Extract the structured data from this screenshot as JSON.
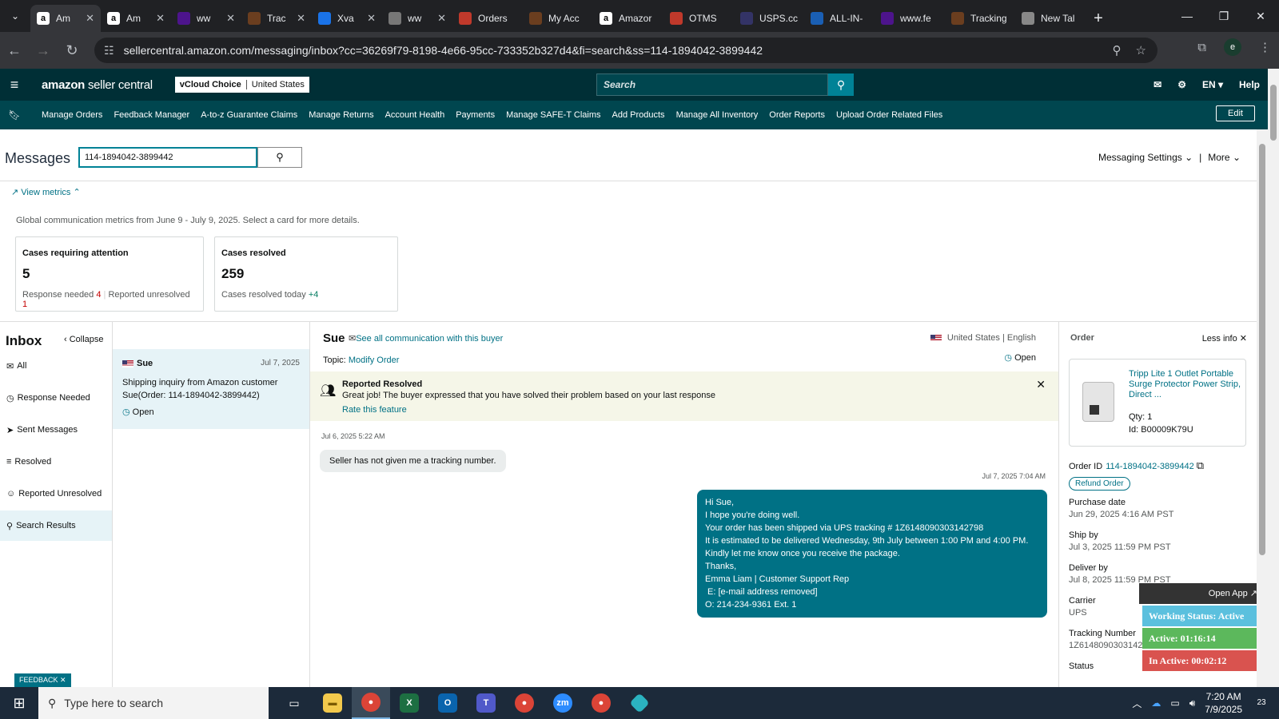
{
  "browser": {
    "tabs": [
      {
        "label": "Am",
        "icon": "amazon-icon",
        "active": true
      },
      {
        "label": "Am",
        "icon": "amazon-icon"
      },
      {
        "label": "ww",
        "icon": "fedex-icon"
      },
      {
        "label": "Trac",
        "icon": "ups-icon"
      },
      {
        "label": "Xva",
        "icon": "google-docs-icon"
      },
      {
        "label": "ww",
        "icon": "globe-icon"
      },
      {
        "label": "Orders",
        "icon": "orders-icon"
      },
      {
        "label": "My Acc",
        "icon": "ups-icon"
      },
      {
        "label": "Amazor",
        "icon": "amazon-icon"
      },
      {
        "label": "OTMS",
        "icon": "otms-icon"
      },
      {
        "label": "USPS.cc",
        "icon": "usps-icon"
      },
      {
        "label": "ALL-IN-",
        "icon": "17track-icon"
      },
      {
        "label": "www.fe",
        "icon": "fedex-icon"
      },
      {
        "label": "Tracking",
        "icon": "ups-icon"
      },
      {
        "label": "New Tal",
        "icon": "chrome-icon"
      }
    ],
    "url": "sellercentral.amazon.com/messaging/inbox?cc=36269f79-8198-4e66-95cc-733352b327d4&fi=search&ss=114-1894042-3899442",
    "profile_initial": "e"
  },
  "header": {
    "logo_main": "amazon",
    "logo_sub": "seller central",
    "account_name": "vCloud Choice",
    "account_region": "United States",
    "search_placeholder": "Search",
    "language": "EN",
    "help": "Help"
  },
  "nav": {
    "links": [
      "Manage Orders",
      "Feedback Manager",
      "A-to-z Guarantee Claims",
      "Manage Returns",
      "Account Health",
      "Payments",
      "Manage SAFE-T Claims",
      "Add Products",
      "Manage All Inventory",
      "Order Reports",
      "Upload Order Related Files"
    ],
    "edit": "Edit"
  },
  "messages": {
    "title": "Messages",
    "search_value": "114-1894042-3899442",
    "settings": "Messaging Settings",
    "more": "More",
    "view_metrics": "View metrics",
    "metrics_desc": "Global communication metrics from June 9 - July 9, 2025. Select a card for more details.",
    "card_attention": {
      "title": "Cases requiring attention",
      "value": "5",
      "response_label": "Response needed",
      "response_value": "4",
      "unresolved_label": "Reported unresolved",
      "unresolved_value": "1"
    },
    "card_resolved": {
      "title": "Cases resolved",
      "value": "259",
      "today_label": "Cases resolved today",
      "today_value": "+4"
    }
  },
  "inbox": {
    "title": "Inbox",
    "collapse": "Collapse",
    "folders": [
      "All",
      "Response Needed",
      "Sent Messages",
      "Resolved",
      "Reported Unresolved",
      "Search Results"
    ]
  },
  "thread": {
    "name": "Sue",
    "date": "Jul 7, 2025",
    "body": "Shipping inquiry from Amazon customer Sue(Order: 114-1894042-3899442)",
    "status": "Open"
  },
  "conversation": {
    "name": "Sue",
    "see_all": "See all communication with this buyer",
    "country": "United States",
    "language": "English",
    "topic_label": "Topic:",
    "topic": "Modify Order",
    "status": "Open",
    "banner_title": "Reported Resolved",
    "banner_desc": "Great job! The buyer expressed that you have solved their problem based on your last response",
    "banner_link": "Rate this feature",
    "msg_in_time": "Jul 6, 2025 5:22 AM",
    "msg_in": "Seller has not given me a tracking number.",
    "msg_out_time": "Jul 7, 2025 7:04 AM",
    "msg_out_lines": [
      "Hi Sue,",
      "I hope you're doing well.",
      "Your order has been shipped via UPS tracking # 1Z6148090303142798",
      "It is estimated to be delivered Wednesday, 9th July between 1:00 PM and 4:00 PM.",
      "Kindly let me know once you receive the package.",
      "Thanks,",
      "Emma Liam | Customer Support Rep",
      " E: [e-mail address removed]",
      "O: 214-234-9361 Ext. 1"
    ]
  },
  "order": {
    "title": "Order",
    "less_info": "Less info",
    "product_name": "Tripp Lite 1 Outlet Portable Surge Protector Power Strip, Direct ...",
    "qty_label": "Qty:",
    "qty": "1",
    "id_label": "Id:",
    "id": "B00009K79U",
    "order_id_label": "Order ID",
    "order_id": "114-1894042-3899442",
    "refund": "Refund Order",
    "fields": [
      {
        "label": "Purchase date",
        "value": "Jun 29, 2025 4:16 AM PST"
      },
      {
        "label": "Ship by",
        "value": "Jul 3, 2025 11:59 PM PST"
      },
      {
        "label": "Deliver by",
        "value": "Jul 8, 2025 11:59 PM PST"
      },
      {
        "label": "Carrier",
        "value": "UPS"
      },
      {
        "label": "Tracking Number",
        "value": "1Z6148090303142798"
      },
      {
        "label": "Status",
        "value": ""
      }
    ]
  },
  "widget": {
    "open_app": "Open App ↗",
    "working": "Working Status: Active",
    "active": "Active: 01:16:14",
    "inactive": "In Active: 00:02:12",
    "colors": {
      "working": "#5bc0de",
      "active": "#5cb85c",
      "inactive": "#d9534f"
    }
  },
  "feedback": "FEEDBACK",
  "taskbar": {
    "search_placeholder": "Type here to search",
    "time": "7:20 AM",
    "date": "7/9/2025",
    "notifications": "23"
  }
}
